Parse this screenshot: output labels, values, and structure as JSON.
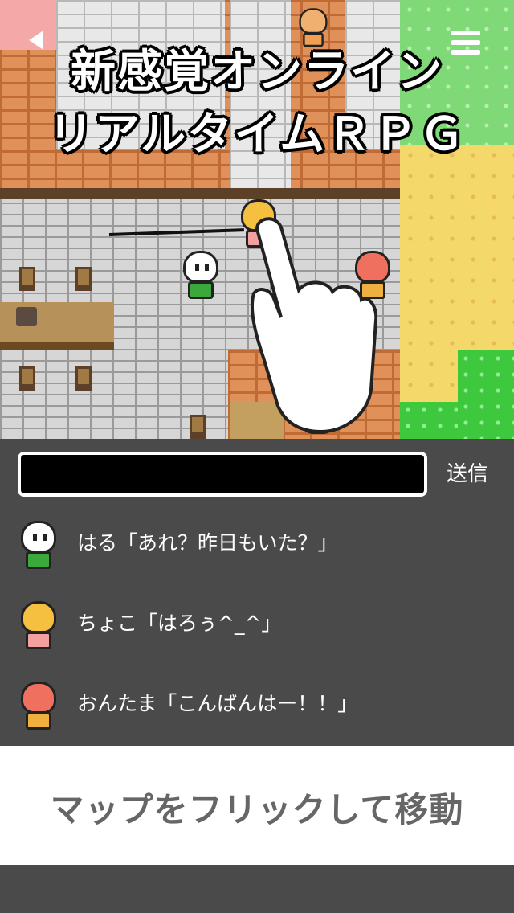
{
  "title": {
    "line1": "新感覚オンライン",
    "line2": "リアルタイムＲＰＧ"
  },
  "icons": {
    "back": "back-arrow-icon",
    "menu": "hamburger-menu-icon",
    "hand": "pointing-hand-icon"
  },
  "chat": {
    "send_label": "送信",
    "input_value": "",
    "messages": [
      {
        "avatar": "haru-avatar-icon",
        "text": "はる「あれ？昨日もいた？」"
      },
      {
        "avatar": "choko-avatar-icon",
        "text": "ちょこ「はろぅ^_^」"
      },
      {
        "avatar": "ontama-avatar-icon",
        "text": "おんたま「こんばんはー！！」"
      }
    ]
  },
  "caption": "マップをフリックして移動",
  "colors": {
    "panel_bg": "#4a4a4a",
    "caption_text": "#666666",
    "brick": "#e0915a",
    "grass": "#7fd977",
    "sand": "#f5d86a"
  }
}
